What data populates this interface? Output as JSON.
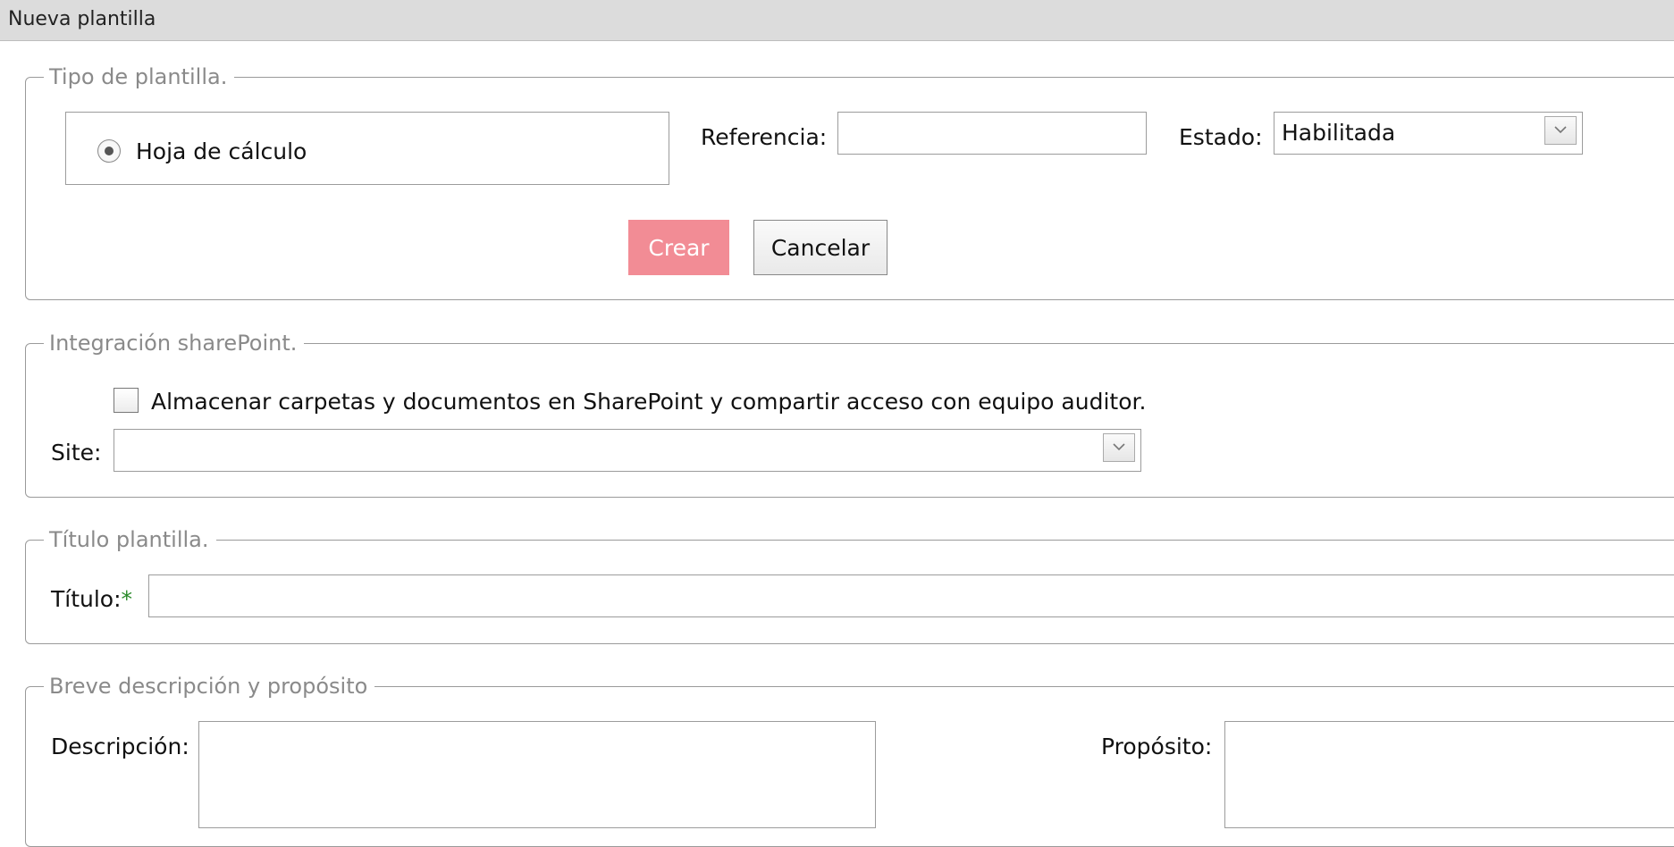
{
  "window": {
    "title": "Nueva plantilla"
  },
  "tipo_plantilla": {
    "legend": "Tipo de plantilla.",
    "radio_label": "Hoja de cálculo",
    "referencia_label": "Referencia:",
    "referencia_value": "",
    "estado_label": "Estado:",
    "estado_value": "Habilitada",
    "crear_label": "Crear",
    "cancelar_label": "Cancelar",
    "crear_color": "#f28c95"
  },
  "sharepoint": {
    "legend": "Integración sharePoint.",
    "checkbox_label": "Almacenar carpetas y documentos en SharePoint y compartir acceso con equipo auditor.",
    "checked": false,
    "site_label": "Site:",
    "site_value": ""
  },
  "titulo_plantilla": {
    "legend": "Título plantilla.",
    "titulo_label": "Título:",
    "required_mark": "*",
    "titulo_value": ""
  },
  "descripcion": {
    "legend": "Breve descripción y propósito",
    "descripcion_label": "Descripción:",
    "proposito_label": "Propósito:"
  },
  "icons": {
    "dropdown": "chevron-down-icon",
    "radio": "radio-selected"
  }
}
